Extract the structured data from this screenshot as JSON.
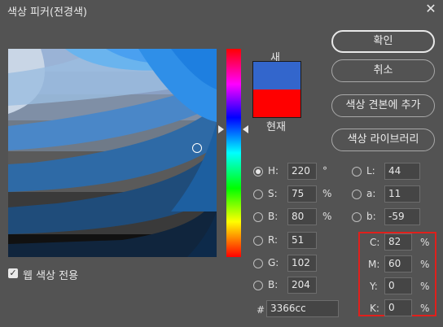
{
  "window": {
    "title": "색상 피커(전경색)",
    "close_glyph": "✕"
  },
  "swatch": {
    "new_label": "새",
    "current_label": "현재",
    "new_color": "#3366cc",
    "current_color": "#ff0000"
  },
  "buttons": {
    "ok": "확인",
    "cancel": "취소",
    "add_to_swatches": "색상 견본에 추가",
    "color_libraries": "색상 라이브러리"
  },
  "hsb": {
    "h": {
      "label": "H:",
      "value": "220",
      "unit": "°",
      "selected": true
    },
    "s": {
      "label": "S:",
      "value": "75",
      "unit": "%"
    },
    "b": {
      "label": "B:",
      "value": "80",
      "unit": "%"
    }
  },
  "lab": {
    "l": {
      "label": "L:",
      "value": "44"
    },
    "a": {
      "label": "a:",
      "value": "11"
    },
    "b": {
      "label": "b:",
      "value": "-59"
    }
  },
  "rgb": {
    "r": {
      "label": "R:",
      "value": "51"
    },
    "g": {
      "label": "G:",
      "value": "102"
    },
    "b": {
      "label": "B:",
      "value": "204"
    }
  },
  "cmyk": {
    "c": {
      "label": "C:",
      "value": "82",
      "unit": "%"
    },
    "m": {
      "label": "M:",
      "value": "60",
      "unit": "%"
    },
    "y": {
      "label": "Y:",
      "value": "0",
      "unit": "%"
    },
    "k": {
      "label": "K:",
      "value": "0",
      "unit": "%"
    }
  },
  "hex": {
    "label": "#",
    "value": "3366cc"
  },
  "web_colors": {
    "label": "웹 색상 전용",
    "checked": true
  },
  "colors": {
    "highlight_frame": "#e0201c"
  }
}
